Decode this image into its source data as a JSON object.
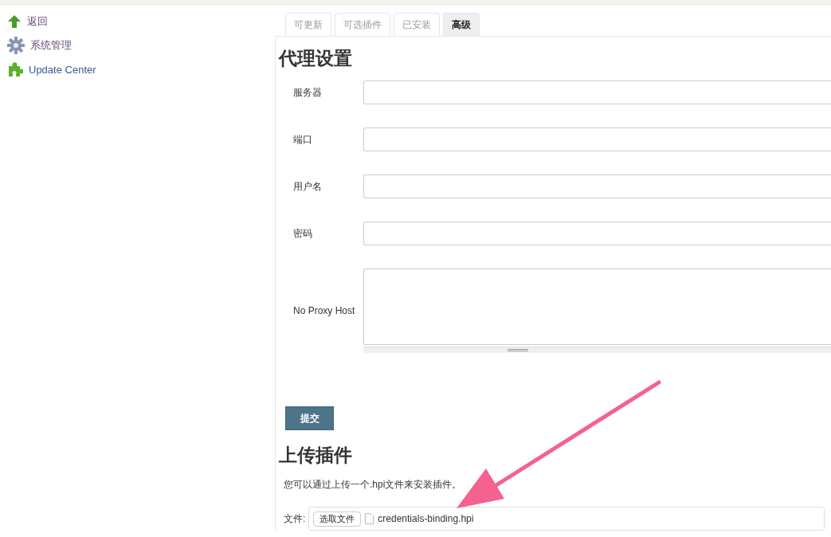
{
  "sidebar": {
    "items": [
      {
        "label": "返回"
      },
      {
        "label": "系统管理"
      },
      {
        "label": "Update Center"
      }
    ]
  },
  "tabs": [
    {
      "label": "可更新",
      "selected": false
    },
    {
      "label": "可选插件",
      "selected": false
    },
    {
      "label": "已安装",
      "selected": false
    },
    {
      "label": "高级",
      "selected": true
    }
  ],
  "proxy": {
    "title": "代理设置",
    "fields": [
      {
        "label": "服务器",
        "kind": "text"
      },
      {
        "label": "端口",
        "kind": "text"
      },
      {
        "label": "用户名",
        "kind": "text"
      },
      {
        "label": "密码",
        "kind": "password"
      },
      {
        "label": "No Proxy Host",
        "kind": "textarea"
      }
    ],
    "submit": "提交"
  },
  "upload": {
    "title": "上传插件",
    "description": "您可以通过上传一个.hpi文件来安装插件。",
    "file_label": "文件:",
    "choose_button": "选取文件",
    "file_name": "credentials-binding.hpi"
  }
}
